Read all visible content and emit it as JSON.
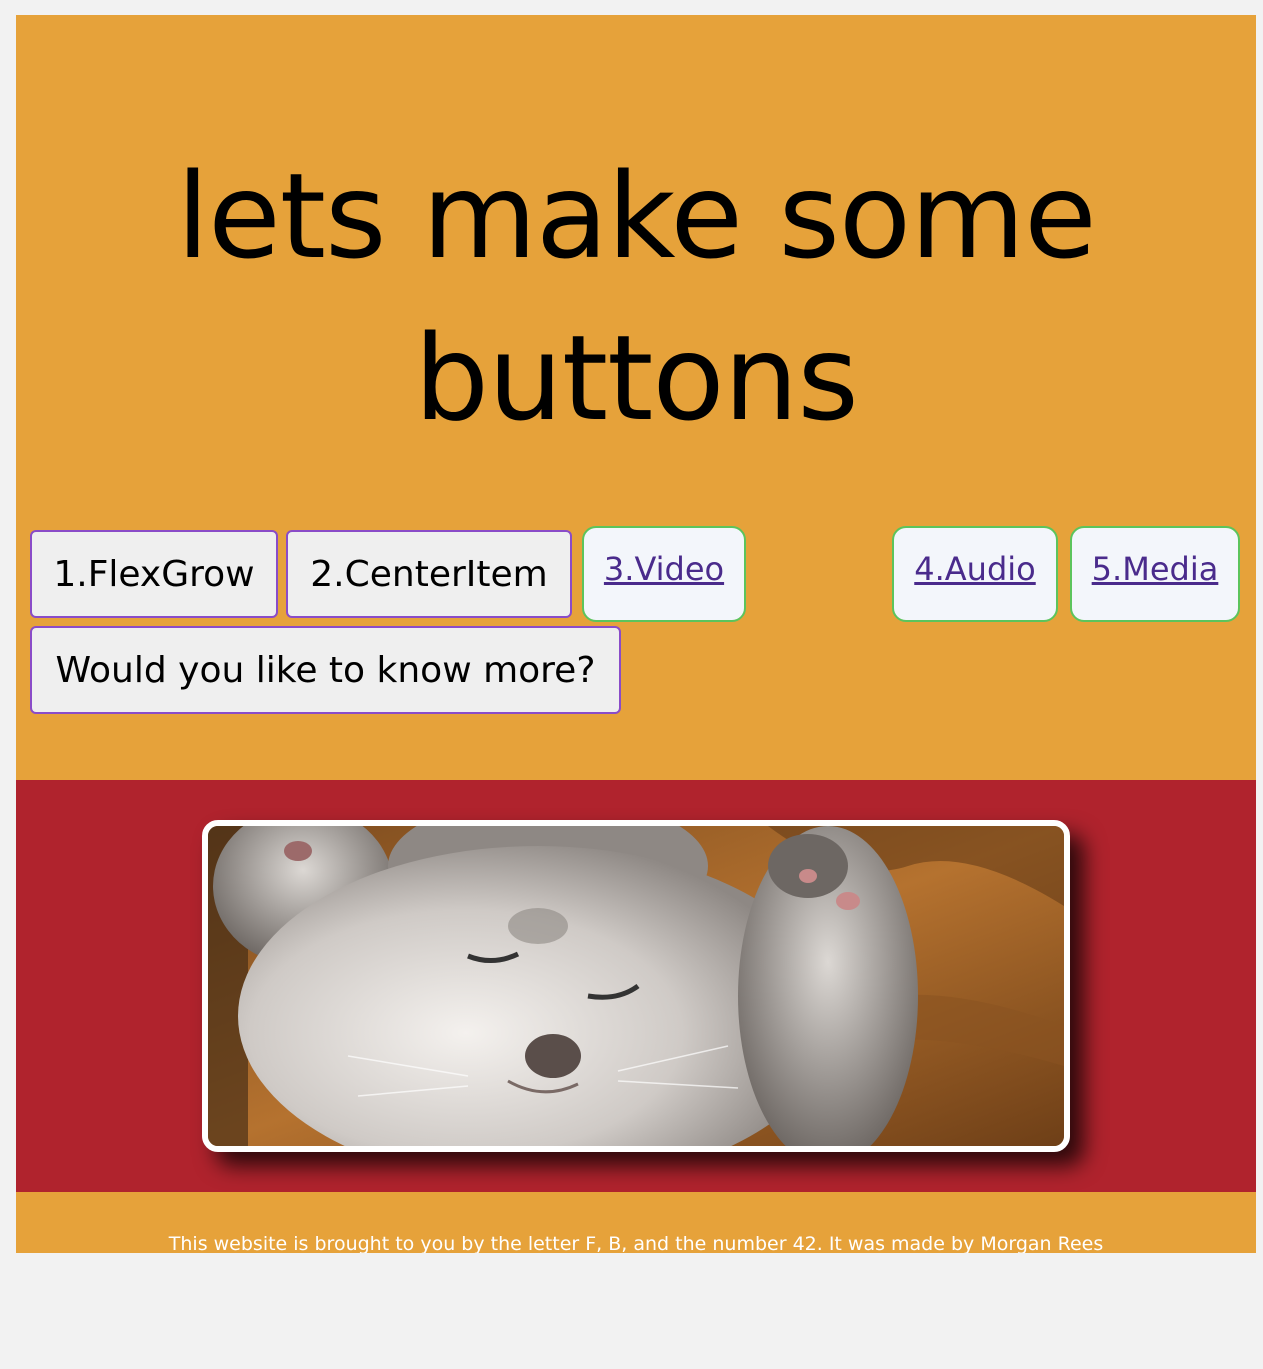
{
  "header": {
    "title_line1": "lets make some",
    "title_line2": "buttons"
  },
  "buttons": {
    "flexgrow": "1.FlexGrow",
    "centeritem": "2.CenterItem",
    "know_more": "Would you like to know more?"
  },
  "links": {
    "video": "3.Video",
    "audio": "4.Audio",
    "media": "5.Media"
  },
  "hero": {
    "image": "sleeping-kitten-photo"
  },
  "footer": {
    "text": "This website is brought to you by the letter F, B, and the number 42. It was made by Morgan Rees"
  },
  "colors": {
    "page_background": "#e6a23a",
    "band_background": "#b0232d",
    "button_border": "#8a4cc8",
    "link_border": "#5cc45c",
    "link_text": "#4a2b8c"
  }
}
